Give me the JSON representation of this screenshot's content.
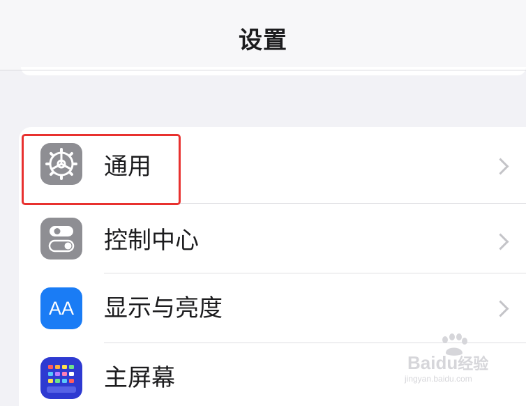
{
  "nav": {
    "title": "设置"
  },
  "rows": [
    {
      "label": "通用",
      "icon": "gear-icon",
      "icon_color": "#8e8e93"
    },
    {
      "label": "控制中心",
      "icon": "toggles-icon",
      "icon_color": "#8e8e93"
    },
    {
      "label": "显示与亮度",
      "icon": "text-size-icon",
      "icon_text": "AA",
      "icon_color": "#1a7cf5"
    },
    {
      "label": "主屏幕",
      "icon": "app-grid-icon",
      "icon_color": "#2e3ad1"
    }
  ],
  "highlight_color": "#e8312f",
  "watermark": {
    "brand": "Baidu",
    "suffix": "经验",
    "url": "jingyan.baidu.com"
  }
}
